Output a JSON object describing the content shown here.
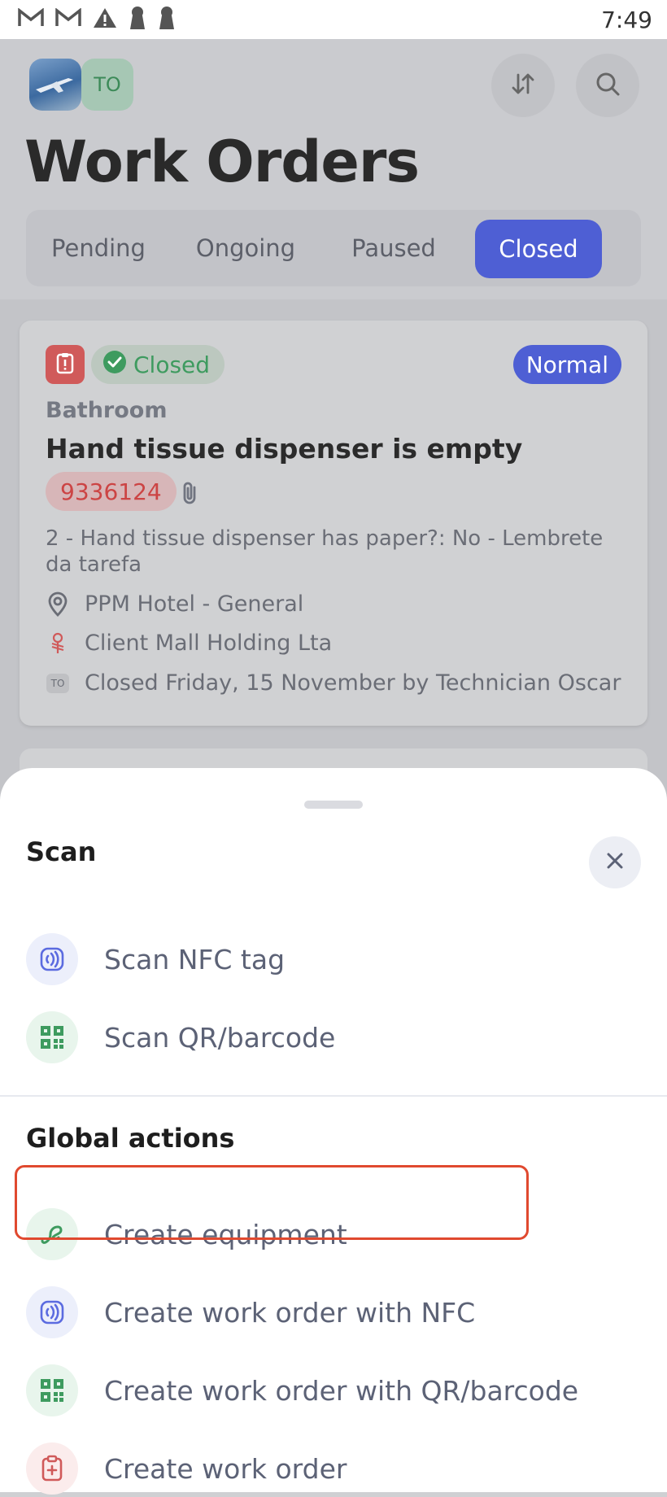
{
  "status_bar": {
    "time": "7:49"
  },
  "header": {
    "avatar_initials": "TO",
    "title": "Work Orders"
  },
  "tabs": [
    {
      "label": "Pending",
      "active": false
    },
    {
      "label": "Ongoing",
      "active": false
    },
    {
      "label": "Paused",
      "active": false
    },
    {
      "label": "Closed",
      "active": true
    }
  ],
  "card": {
    "status": "Closed",
    "priority": "Normal",
    "category": "Bathroom",
    "title": "Hand tissue dispenser is empty",
    "number": "9336124",
    "description": "2 - Hand tissue dispenser has paper?: No - Lembrete da tarefa",
    "location": "PPM Hotel - General",
    "client": "Client Mall Holding Lta",
    "closed_by_initials": "TO",
    "closed_info": "Closed Friday, 15 November by Technician Oscar"
  },
  "sheet": {
    "title": "Scan",
    "scan_items": [
      {
        "label": "Scan NFC tag",
        "icon": "nfc-icon"
      },
      {
        "label": "Scan QR/barcode",
        "icon": "qr-icon"
      }
    ],
    "section_title": "Global actions",
    "actions": [
      {
        "label": "Create equipment",
        "icon": "equipment-icon"
      },
      {
        "label": "Create work order with NFC",
        "icon": "nfc-icon"
      },
      {
        "label": "Create work order with QR/barcode",
        "icon": "qr-icon"
      },
      {
        "label": "Create work order",
        "icon": "clipboard-plus-icon"
      }
    ]
  },
  "colors": {
    "accent": "#4e5fd4",
    "success": "#3e9b5f",
    "danger": "#d05a5a",
    "highlight": "#e0492f"
  }
}
